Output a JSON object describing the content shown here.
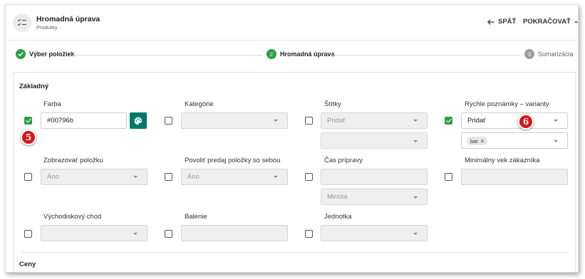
{
  "header": {
    "icon": "checklist-icon",
    "title": "Hromadná úprava",
    "subtitle": "Produkty",
    "back_label": "SPÄŤ",
    "next_label": "POKRAČOVAŤ"
  },
  "stepper": {
    "steps": [
      {
        "label": "Výber položiek",
        "marker": "",
        "state": "done"
      },
      {
        "label": "Hromadná úprava",
        "marker": "2",
        "state": "active"
      },
      {
        "label": "Sumarizácia",
        "marker": "3",
        "state": "pending"
      }
    ]
  },
  "colors": {
    "accent": "#2e9e4a",
    "palette_button": "#00796b",
    "badge": "#d6161c"
  },
  "sections": {
    "basic": "Základný",
    "prices": "Ceny"
  },
  "fields": {
    "farba": {
      "label": "Farba",
      "value": "#00796b",
      "checked": true
    },
    "kategorie": {
      "label": "Kategórie",
      "value": "",
      "checked": false
    },
    "stitky": {
      "label": "Štítky",
      "placeholder": "Pridať",
      "checked": false
    },
    "rychle": {
      "label": "Rýchle poznámky – varianty",
      "value": "Pridať",
      "chip": "bar",
      "checked": true
    },
    "zobrazovat": {
      "label": "Zobrazovať položku",
      "value": "Áno",
      "checked": false
    },
    "povolit": {
      "label": "Povoliť predaj položky so sebou",
      "value": "Áno",
      "checked": false
    },
    "cas": {
      "label": "Čas prípravy",
      "value": "",
      "unit": "Minúta",
      "checked": false
    },
    "minvek": {
      "label": "Minimálny vek zákazníka",
      "value": "",
      "checked": false
    },
    "vychodiskovy": {
      "label": "Východiskový chod",
      "value": "",
      "checked": false
    },
    "balenie": {
      "label": "Balenie",
      "value": "",
      "checked": false
    },
    "jednotka": {
      "label": "Jednotka",
      "value": "",
      "checked": false
    }
  },
  "annotations": {
    "badge5": "5",
    "badge6": "6"
  }
}
